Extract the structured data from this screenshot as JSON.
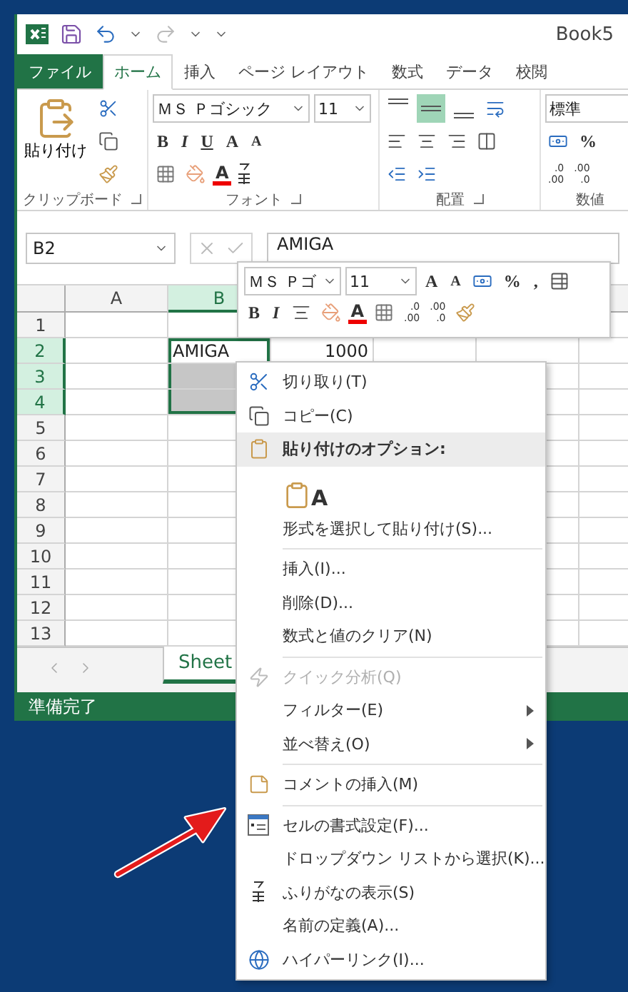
{
  "title_bar": {
    "title": "Book5"
  },
  "ribbon_tabs": [
    {
      "label": "ファイル",
      "kind": "file",
      "selected": false
    },
    {
      "label": "ホーム",
      "kind": "tab",
      "selected": true
    },
    {
      "label": "挿入",
      "kind": "tab",
      "selected": false
    },
    {
      "label": "ページ レイアウト",
      "kind": "tab",
      "selected": false
    },
    {
      "label": "数式",
      "kind": "tab",
      "selected": false
    },
    {
      "label": "データ",
      "kind": "tab",
      "selected": false
    },
    {
      "label": "校閲",
      "kind": "tab",
      "selected": false
    }
  ],
  "clipboard": {
    "paste": "貼り付け",
    "label": "クリップボード"
  },
  "font": {
    "name": "ＭＳ Ｐゴシック",
    "size": "11",
    "styles": [
      "B",
      "I",
      "U"
    ],
    "grow": "A",
    "shrink": "A",
    "font_color": "A",
    "label": "フォント"
  },
  "alignment": {
    "vertical": [
      {
        "selected": false
      },
      {
        "selected": true
      },
      {
        "selected": false
      }
    ],
    "label": "配置"
  },
  "number": {
    "format": "標準",
    "percent": "%",
    "decimals": [
      {
        "top": ".0",
        "bottom": ".00"
      },
      {
        "top": ".00",
        "bottom": ".0"
      }
    ],
    "label": "数値"
  },
  "formula_bar": {
    "name_box": "B2",
    "value": "AMIGA"
  },
  "columns": [
    {
      "label": "A",
      "selected": false
    },
    {
      "label": "B",
      "selected": true
    }
  ],
  "rows": [
    {
      "header": "1",
      "selected": false
    },
    {
      "header": "2",
      "selected": true,
      "cells": {
        "B": "AMIGA",
        "C": "1000"
      }
    },
    {
      "header": "3",
      "selected": true
    },
    {
      "header": "4",
      "selected": true
    },
    {
      "header": "5",
      "selected": false
    },
    {
      "header": "6",
      "selected": false
    },
    {
      "header": "7",
      "selected": false
    },
    {
      "header": "8",
      "selected": false
    },
    {
      "header": "9",
      "selected": false
    },
    {
      "header": "10",
      "selected": false
    },
    {
      "header": "11",
      "selected": false
    },
    {
      "header": "12",
      "selected": false
    },
    {
      "header": "13",
      "selected": false
    }
  ],
  "sheet_tab": {
    "label": "Sheet"
  },
  "status_bar": {
    "text": "準備完了"
  },
  "mini_toolbar": {
    "font": "ＭＳ Ｐゴ",
    "size": "11",
    "grow": "A",
    "shrink": "A",
    "percent": "%",
    "comma": ",",
    "bold": "B",
    "italic": "I",
    "font_color": "A",
    "decimals": [
      {
        "top": ".0",
        "bottom": ".00"
      },
      {
        "top": ".00",
        "bottom": ".0"
      }
    ]
  },
  "context_menu": [
    {
      "kind": "item",
      "label": "切り取り(T)",
      "disabled": false
    },
    {
      "kind": "item",
      "label": "コピー(C)",
      "disabled": false
    },
    {
      "kind": "header",
      "label": "貼り付けのオプション:",
      "disabled": false
    },
    {
      "kind": "paste",
      "label": "A",
      "disabled": false
    },
    {
      "kind": "item",
      "label": "形式を選択して貼り付け(S)...",
      "disabled": false
    },
    {
      "kind": "separator"
    },
    {
      "kind": "item",
      "label": "挿入(I)...",
      "disabled": false
    },
    {
      "kind": "item",
      "label": "削除(D)...",
      "disabled": false
    },
    {
      "kind": "item",
      "label": "数式と値のクリア(N)",
      "disabled": false
    },
    {
      "kind": "separator"
    },
    {
      "kind": "item",
      "label": "クイック分析(Q)",
      "disabled": true
    },
    {
      "kind": "submenu",
      "label": "フィルター(E)",
      "disabled": false
    },
    {
      "kind": "submenu",
      "label": "並べ替え(O)",
      "disabled": false
    },
    {
      "kind": "separator"
    },
    {
      "kind": "item",
      "label": "コメントの挿入(M)",
      "disabled": false
    },
    {
      "kind": "separator"
    },
    {
      "kind": "item",
      "label": "セルの書式設定(F)...",
      "disabled": false
    },
    {
      "kind": "item",
      "label": "ドロップダウン リストから選択(K)...",
      "disabled": false
    },
    {
      "kind": "item",
      "label": "ふりがなの表示(S)",
      "disabled": false
    },
    {
      "kind": "item",
      "label": "名前の定義(A)...",
      "disabled": false
    },
    {
      "kind": "item",
      "label": "ハイパーリンク(I)...",
      "disabled": false
    }
  ]
}
